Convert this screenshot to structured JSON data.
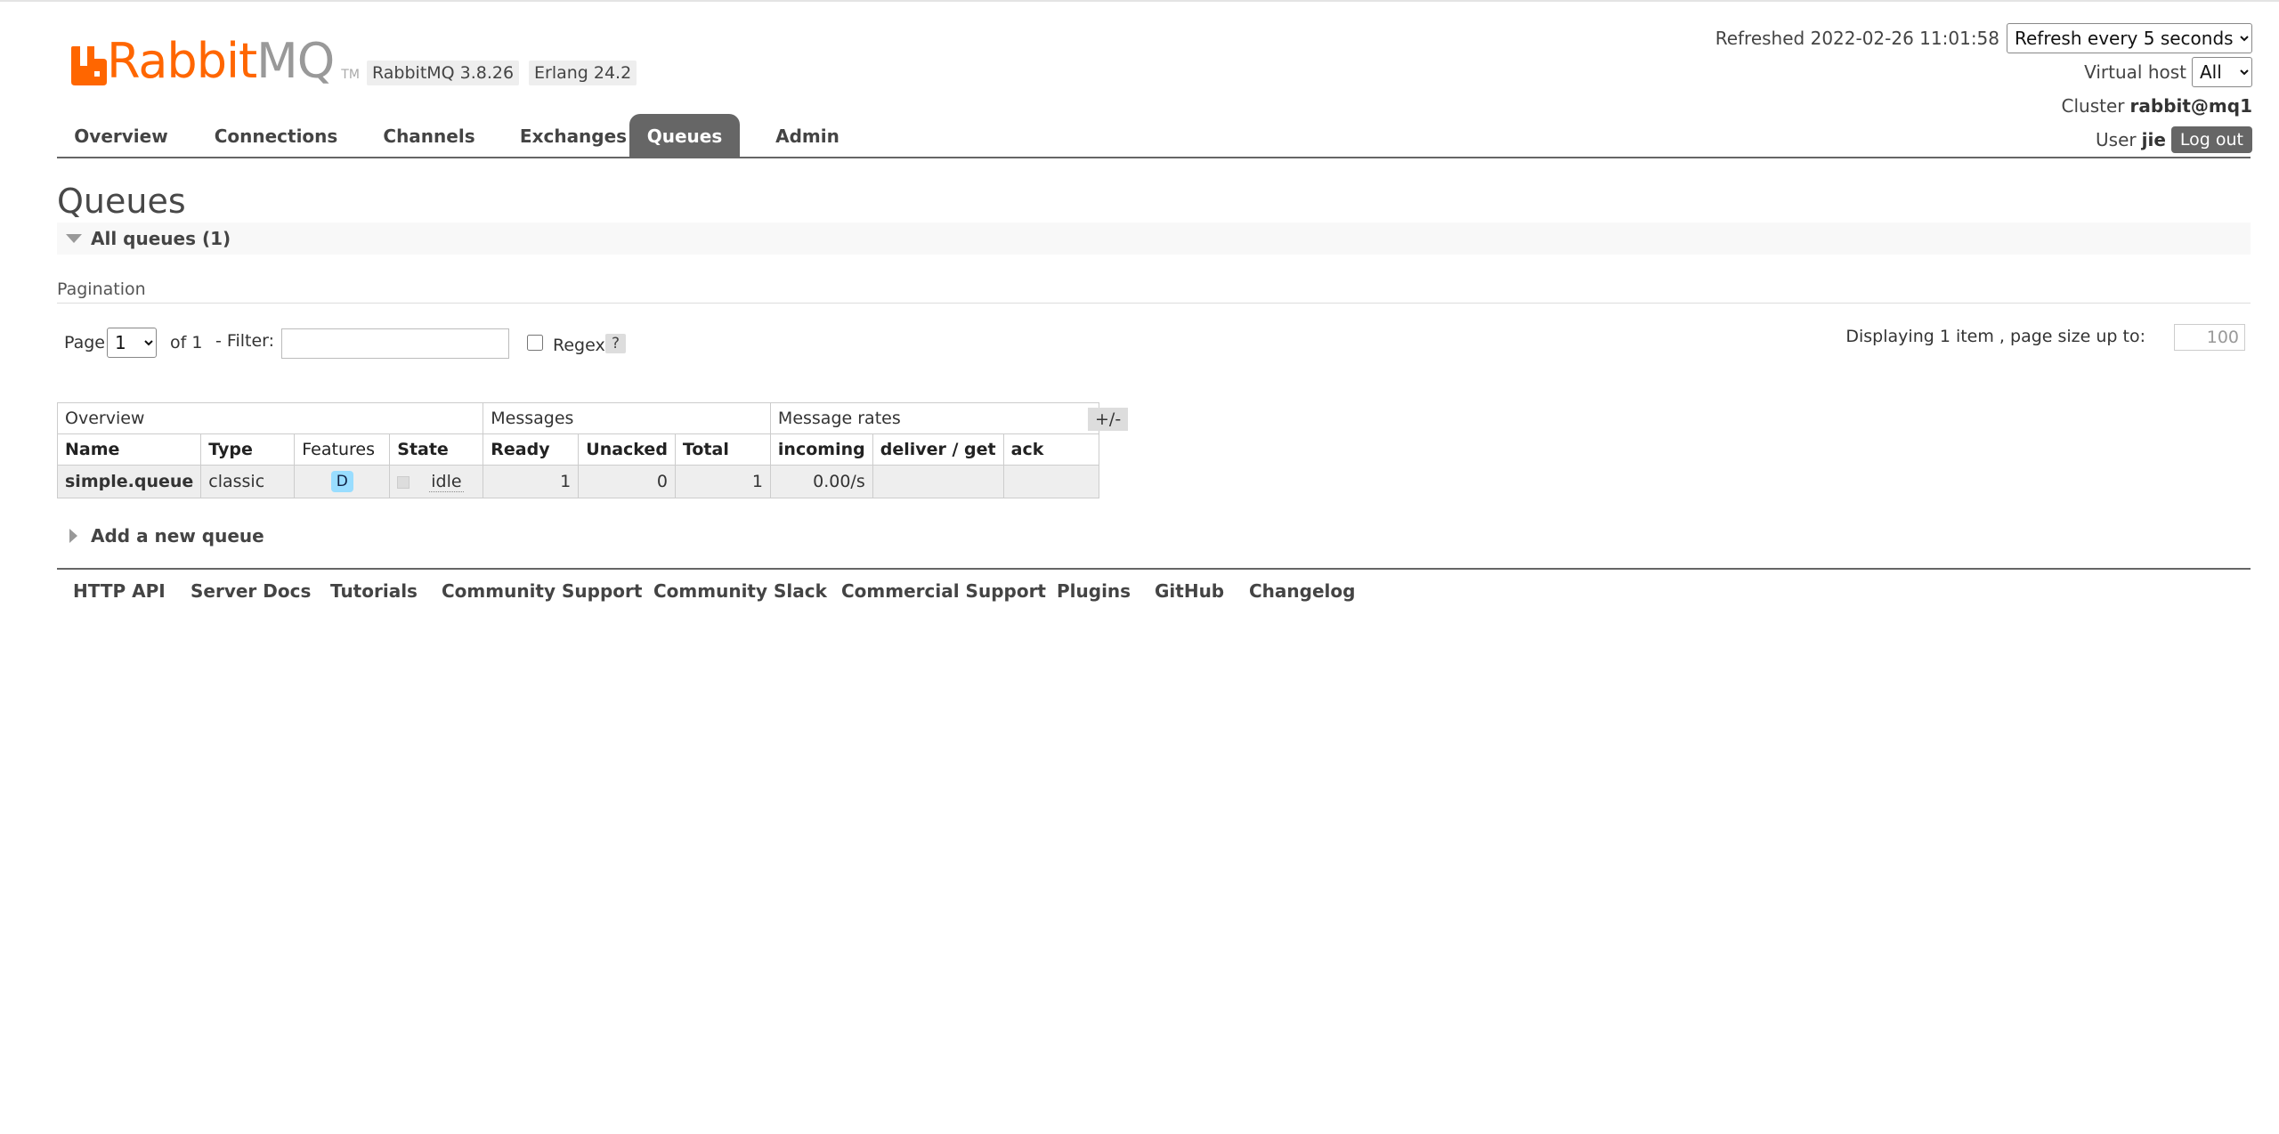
{
  "header": {
    "logo_rabbit": "Rabbit",
    "logo_mq": "MQ",
    "logo_tm": "TM",
    "version_badge": "RabbitMQ 3.8.26",
    "erlang_badge": "Erlang 24.2",
    "refreshed_label": "Refreshed 2022-02-26 11:01:58",
    "refresh_select": "Refresh every 5 seconds",
    "virtual_host_label": "Virtual host",
    "virtual_host_value": "All",
    "cluster_label": "Cluster",
    "cluster_value": "rabbit@mq1",
    "user_label": "User",
    "user_value": "jie",
    "logout_label": "Log out"
  },
  "nav": {
    "tabs": [
      {
        "label": "Overview"
      },
      {
        "label": "Connections"
      },
      {
        "label": "Channels"
      },
      {
        "label": "Exchanges"
      },
      {
        "label": "Queues",
        "active": true
      },
      {
        "label": "Admin"
      }
    ]
  },
  "main": {
    "title": "Queues",
    "section_title": "All queues (1)",
    "pagination_label": "Pagination",
    "page_label": "Page",
    "page_value": "1",
    "of_label": "of 1",
    "filter_label": "- Filter:",
    "filter_value": "",
    "regex_label": "Regex",
    "help_label": "?",
    "displaying_label": "Displaying 1 item , page size up to:",
    "page_size": "100",
    "plusminus": "+/-",
    "add_queue_label": "Add a new queue"
  },
  "table": {
    "groups": [
      "Overview",
      "Messages",
      "Message rates"
    ],
    "columns": [
      "Name",
      "Type",
      "Features",
      "State",
      "Ready",
      "Unacked",
      "Total",
      "incoming",
      "deliver / get",
      "ack"
    ],
    "rows": [
      {
        "name": "simple.queue",
        "type": "classic",
        "features": "D",
        "state": "idle",
        "ready": "1",
        "unacked": "0",
        "total": "1",
        "incoming": "0.00/s",
        "deliver_get": "",
        "ack": ""
      }
    ]
  },
  "footer": {
    "links": [
      "HTTP API",
      "Server Docs",
      "Tutorials",
      "Community Support",
      "Community Slack",
      "Commercial Support",
      "Plugins",
      "GitHub",
      "Changelog"
    ]
  },
  "colors": {
    "brand_orange": "#ff6600",
    "nav_active": "#666666",
    "feature_badge": "#99ddff"
  }
}
